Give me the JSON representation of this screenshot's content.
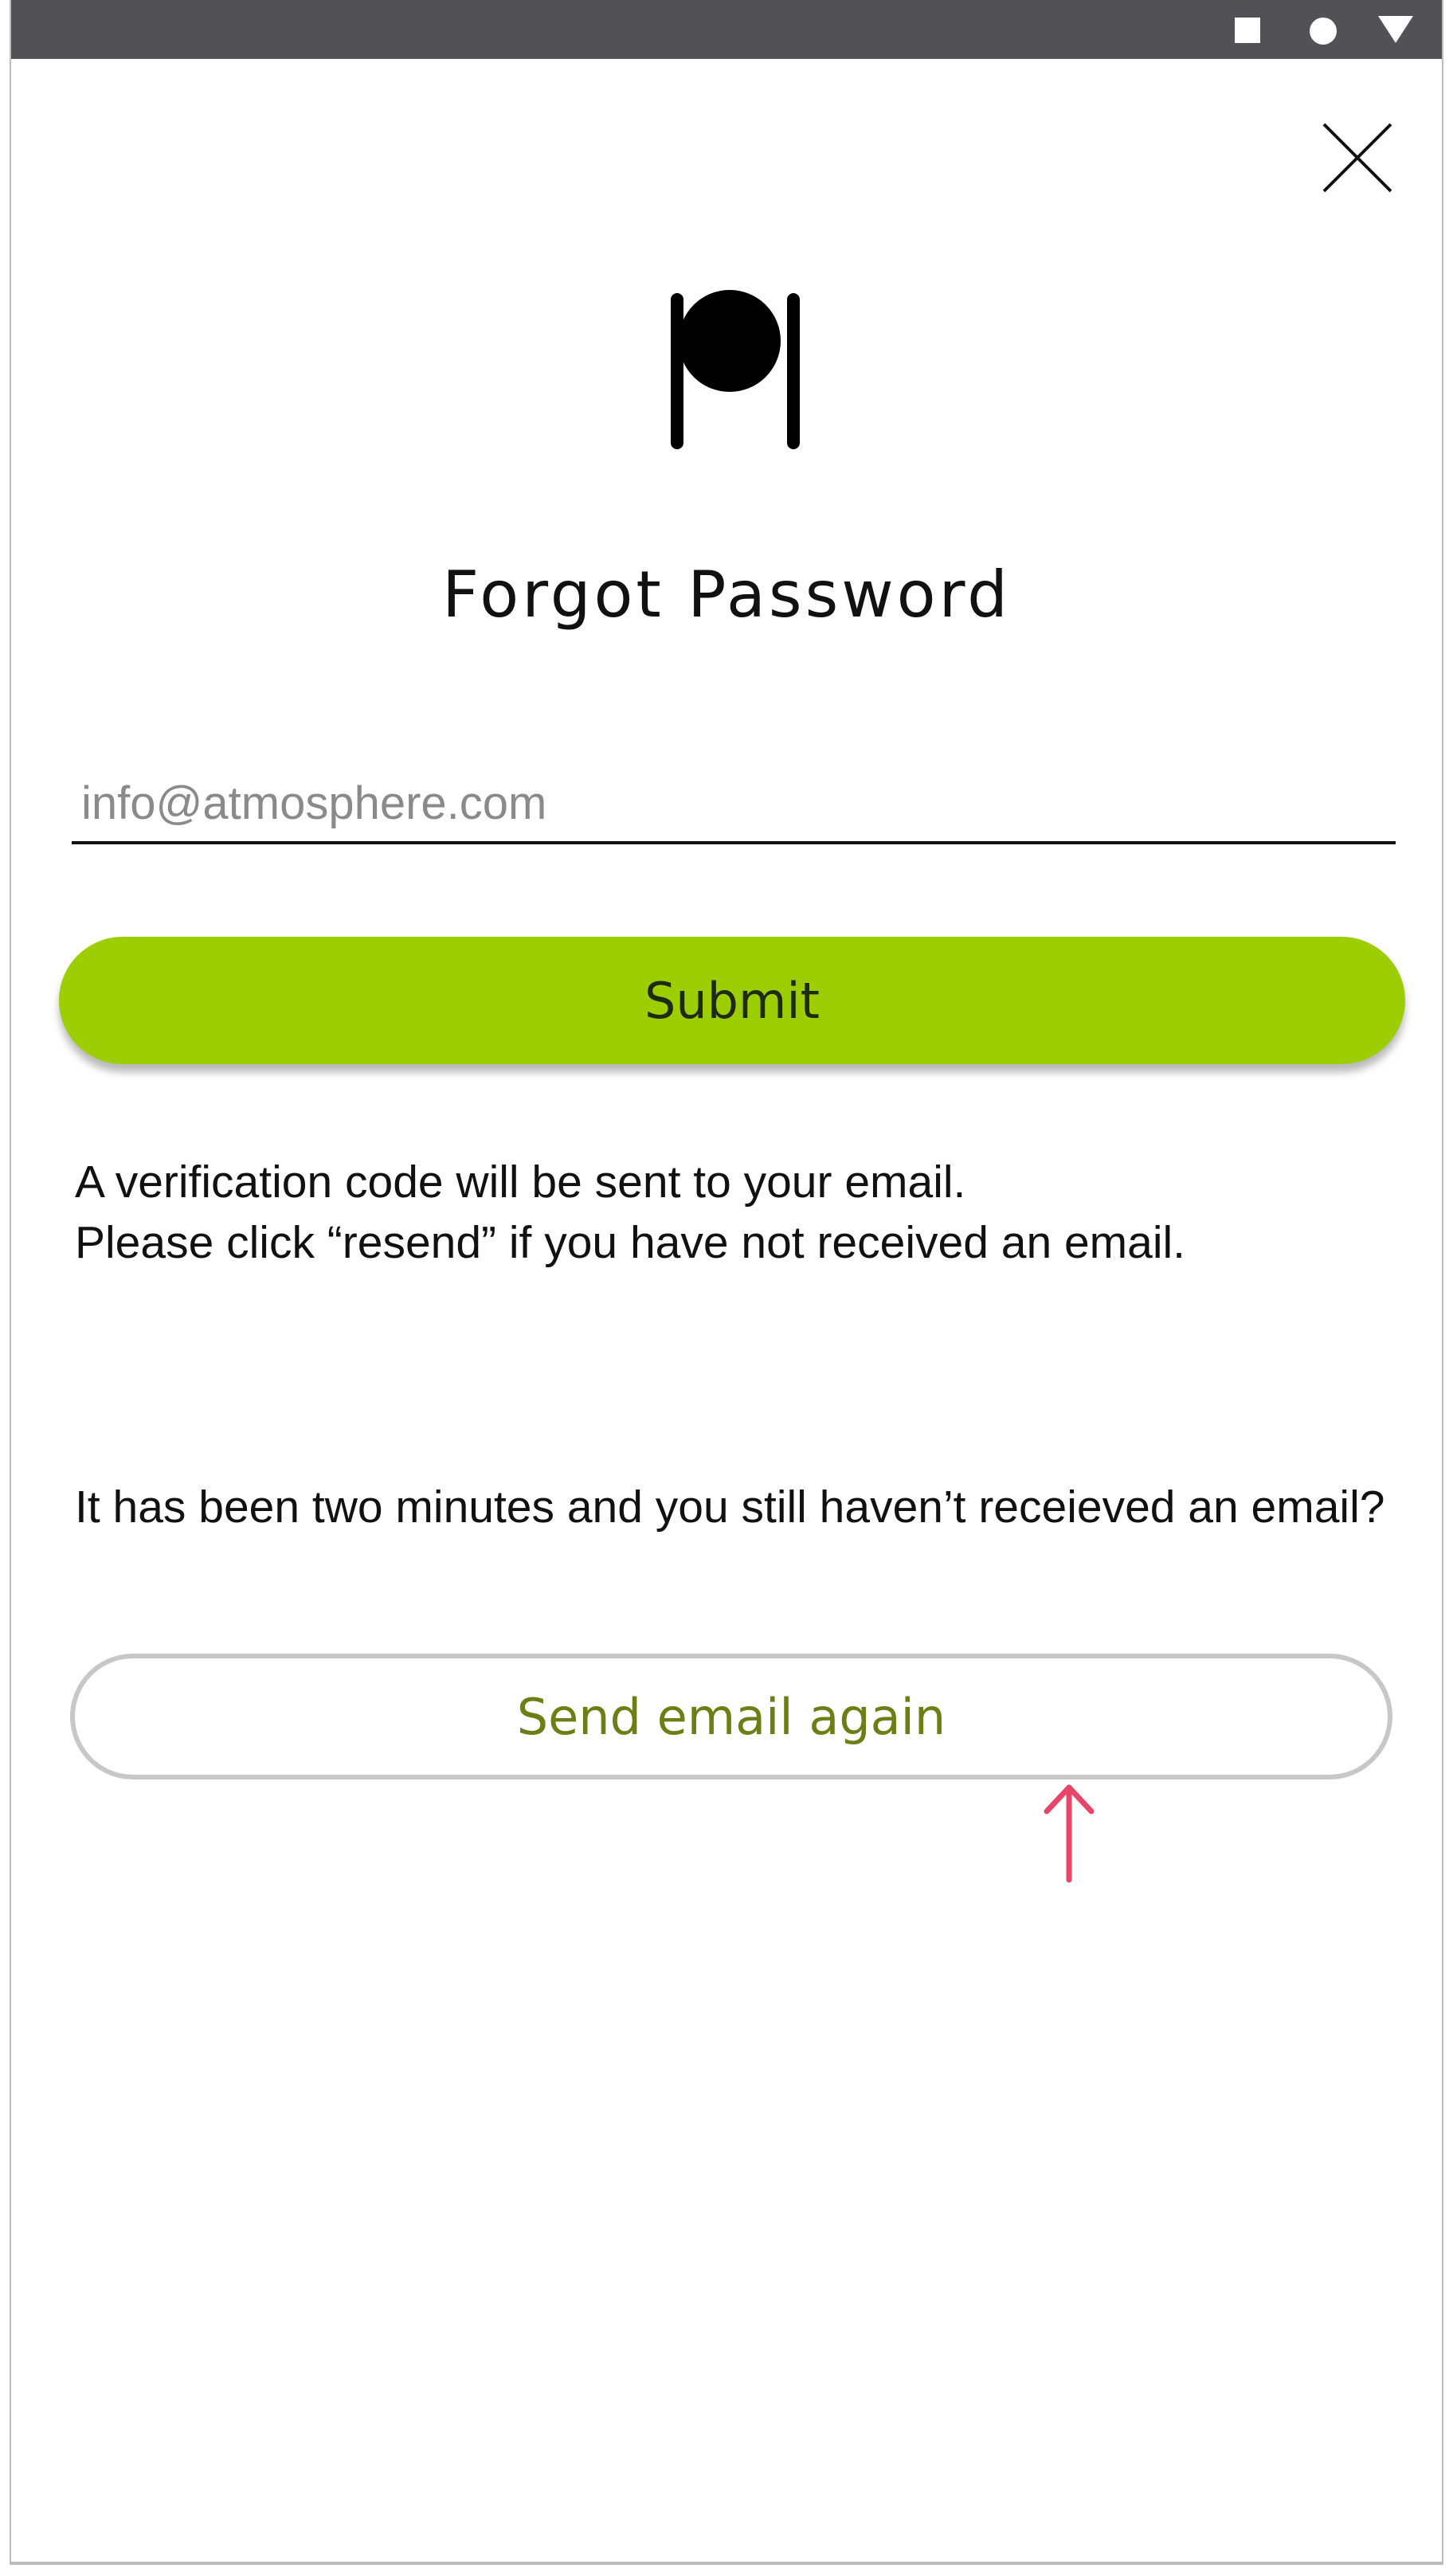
{
  "screen": {
    "title": "Forgot Password",
    "email_placeholder": "info@atmosphere.com",
    "submit_label": "Submit",
    "info_line1": "A verification code will be sent to your email.",
    "info_line2": "Please click “resend” if you have not received an email.",
    "resend_prompt": "It has been two minutes and you still haven’t receieved an email?",
    "resend_label": "Send email again"
  },
  "colors": {
    "accent": "#9dce04",
    "resend_text": "#6b7f14",
    "arrow": "#e8456b",
    "status_bar": "#525156"
  },
  "icons": {
    "status": [
      "square-icon",
      "circle-icon",
      "triangle-down-icon"
    ],
    "close": "close-icon",
    "logo": "plate-logo-icon",
    "hint": "arrow-up-icon"
  }
}
